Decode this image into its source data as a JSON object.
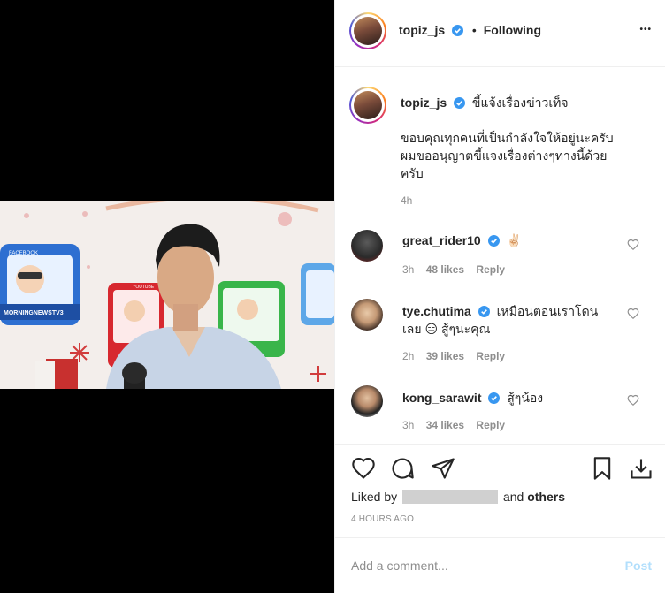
{
  "header": {
    "username": "topiz_js",
    "separator": "•",
    "follow_status": "Following",
    "more": "•••"
  },
  "caption": {
    "username": "topiz_js",
    "title": "ขี้แจ้งเรื่องข่าวเท็จ",
    "body_line1": "ขอบคุณทุกคนที่เป็นกำลังใจให้อยู่นะครับ",
    "body_line2": "ผมขออนุญาตขี้แจงเรื่องต่างๆทางนี้ด้วย",
    "body_line3": "ครับ",
    "time": "4h"
  },
  "comments": [
    {
      "username": "great_rider10",
      "text": "✌🏻",
      "time": "3h",
      "likes": "48 likes",
      "reply": "Reply"
    },
    {
      "username": "tye.chutima",
      "text_line1": "เหมือนตอนเราโดน",
      "text_line2": "เลย 😑 สู้ๆนะคุณ",
      "time": "2h",
      "likes": "39 likes",
      "reply": "Reply"
    },
    {
      "username": "kong_sarawit",
      "text": "สู้ๆน้อง",
      "time": "3h",
      "likes": "34 likes",
      "reply": "Reply"
    }
  ],
  "likes": {
    "prefix": "Liked by",
    "suffix_and": "and",
    "others": "others"
  },
  "timestamp": "4 HOURS AGO",
  "add_comment": {
    "placeholder": "Add a comment...",
    "post_label": "Post"
  },
  "video": {
    "logo_text": "MORNINGNEWSTV3",
    "facebook_label": "FACEBOOK",
    "youtube_label": "YOUTUBE"
  },
  "colors": {
    "verified_blue": "#3897f0",
    "link_blue": "#b2dffc",
    "muted": "#8e8e8e"
  }
}
